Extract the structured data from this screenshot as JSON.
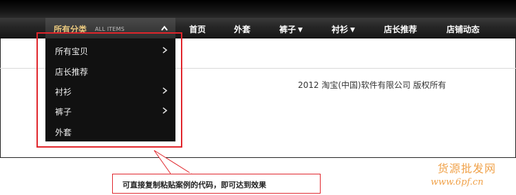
{
  "nav": {
    "all_items": {
      "label": "所有分类",
      "sub_label": "ALL ITEMS"
    },
    "items": [
      {
        "label": "首页",
        "has_dropdown": false
      },
      {
        "label": "外套",
        "has_dropdown": false
      },
      {
        "label": "裤子",
        "has_dropdown": true
      },
      {
        "label": "衬衫",
        "has_dropdown": true
      },
      {
        "label": "店长推荐",
        "has_dropdown": false
      },
      {
        "label": "店铺动态",
        "has_dropdown": false
      }
    ]
  },
  "dropdown": {
    "items": [
      {
        "label": "所有宝贝",
        "has_submenu": true
      },
      {
        "label": "店长推荐",
        "has_submenu": false
      },
      {
        "label": "衬衫",
        "has_submenu": true
      },
      {
        "label": "裤子",
        "has_submenu": true
      },
      {
        "label": "外套",
        "has_submenu": false
      }
    ]
  },
  "footer": {
    "copyright": "2012 淘宝(中国)软件有限公司 版权所有"
  },
  "annotation": {
    "callout_text": "可直接复制粘贴案例的代码，即可达到效果"
  },
  "watermark": {
    "line1": "货源批发网",
    "line2": "www.6pf.cn"
  },
  "colors": {
    "nav_bg": "#262626",
    "all_items_label": "#e8c77e",
    "dropdown_bg": "#111111",
    "highlight_red": "#e0252b",
    "watermark": "#f0a24a"
  }
}
